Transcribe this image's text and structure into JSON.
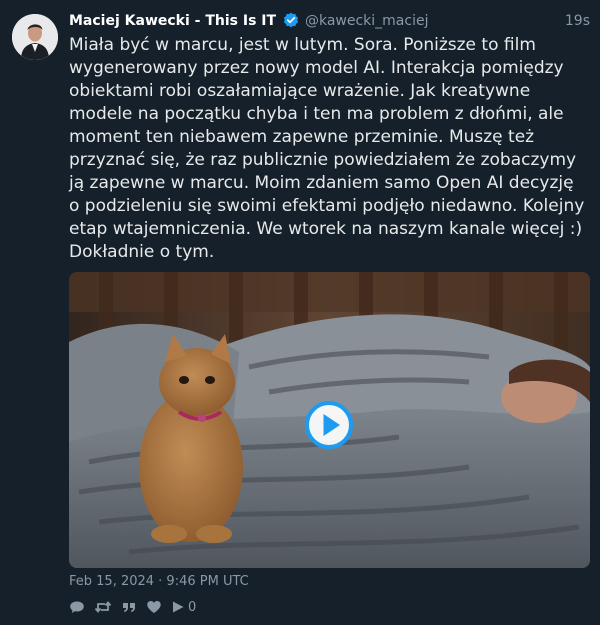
{
  "author": {
    "name": "Maciej Kawecki - This Is IT",
    "handle": "@kawecki_maciej",
    "verified": true
  },
  "tweet": {
    "age": "19s",
    "text": "Miała być w marcu, jest w lutym. Sora. Poniższe to film wygenerowany przez nowy model AI. Interakcja pomiędzy obiektami robi oszałamiające wrażenie. Jak kreatywne modele na początku chyba i ten ma problem z dłońmi, ale moment ten niebawem zapewne przeminie. Muszę też przyznać się, że raz publicznie powiedziałem że zobaczymy ją zapewne w marcu. Moim zdaniem samo Open AI decyzję o podzieleniu się swoimi efektami podjęło niedawno. Kolejny etap wtajemniczenia. We wtorek na naszym kanale więcej :) Dokładnie o tym.",
    "timestamp": "Feb 15, 2024 · 9:46 PM UTC",
    "media_type": "video"
  },
  "actions": {
    "views_count": "0"
  },
  "colors": {
    "background": "#15202b",
    "accent": "#1d9bf0",
    "muted": "#8b98a5"
  },
  "icons": [
    "verified-badge-icon",
    "play-icon",
    "reply-icon",
    "retweet-icon",
    "quote-icon",
    "like-icon",
    "views-icon"
  ]
}
